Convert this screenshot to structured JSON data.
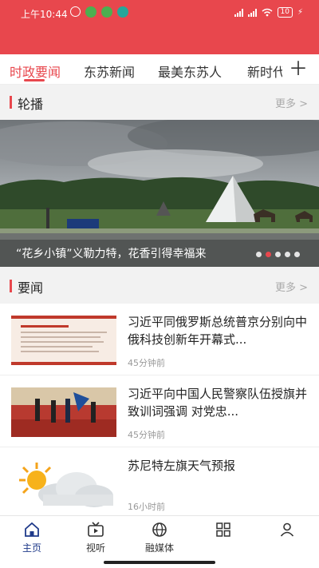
{
  "status": {
    "time": "上午10:44",
    "battery": "10"
  },
  "tabs": [
    {
      "label": "时政要闻",
      "active": true
    },
    {
      "label": "东苏新闻",
      "active": false
    },
    {
      "label": "最美东苏人",
      "active": false
    },
    {
      "label": "新时代",
      "active": false
    }
  ],
  "tab_add_icon": "plus-icon",
  "carousel_section": {
    "title": "轮播",
    "more": "更多 >"
  },
  "carousel": {
    "caption": "“花乡小镇”义勒力特，花香引得幸福来",
    "dot_count": 5,
    "active_dot": 1
  },
  "news_section": {
    "title": "要闻",
    "more": "更多 >"
  },
  "news": [
    {
      "title": "习近平同俄罗斯总统普京分别向中俄科技创新年开幕式...",
      "time": "45分钟前"
    },
    {
      "title": "习近平向中国人民警察队伍授旗并致训词强调  对党忠...",
      "time": "45分钟前"
    },
    {
      "title": "苏尼特左旗天气预报",
      "time": "16小时前"
    }
  ],
  "nav": [
    {
      "label": "主页",
      "icon": "home-icon",
      "active": true
    },
    {
      "label": "视听",
      "icon": "tv-icon",
      "active": false
    },
    {
      "label": "融媒体",
      "icon": "globe-icon",
      "active": false
    },
    {
      "label": "",
      "icon": "grid-icon",
      "active": false
    },
    {
      "label": "",
      "icon": "user-icon",
      "active": false
    }
  ],
  "colors": {
    "brand": "#e8474d",
    "nav_active": "#1f3a8a"
  }
}
